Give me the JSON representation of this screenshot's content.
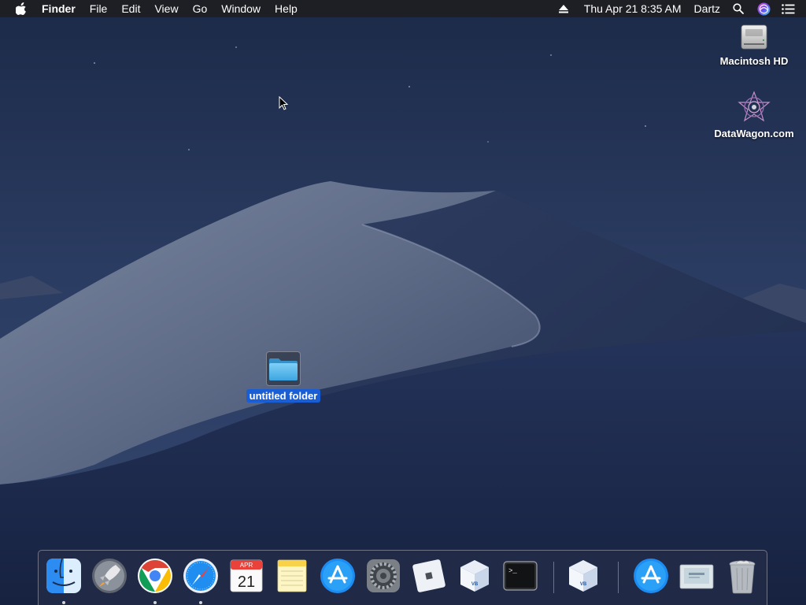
{
  "menubar": {
    "app_name": "Finder",
    "items": [
      "File",
      "Edit",
      "View",
      "Go",
      "Window",
      "Help"
    ],
    "datetime": "Thu Apr 21  8:35 AM",
    "user": "Dartz"
  },
  "desktop_icons": {
    "hd_label": "Macintosh HD",
    "datawagon_label": "DataWagon.com",
    "folder_label": "untitled folder"
  },
  "dock": {
    "calendar_month": "APR",
    "calendar_day": "21",
    "terminal_prompt": ">_",
    "items": [
      "Finder",
      "Launchpad",
      "Google Chrome",
      "Safari",
      "Calendar",
      "Notes",
      "App Store",
      "System Preferences",
      "Roblox",
      "VirtualBox",
      "Terminal",
      "VirtualBox",
      "App Store",
      "Windows",
      "Trash"
    ]
  },
  "colors": {
    "selection": "#1a5ed6",
    "menubar_bg": "#1e1e22"
  }
}
